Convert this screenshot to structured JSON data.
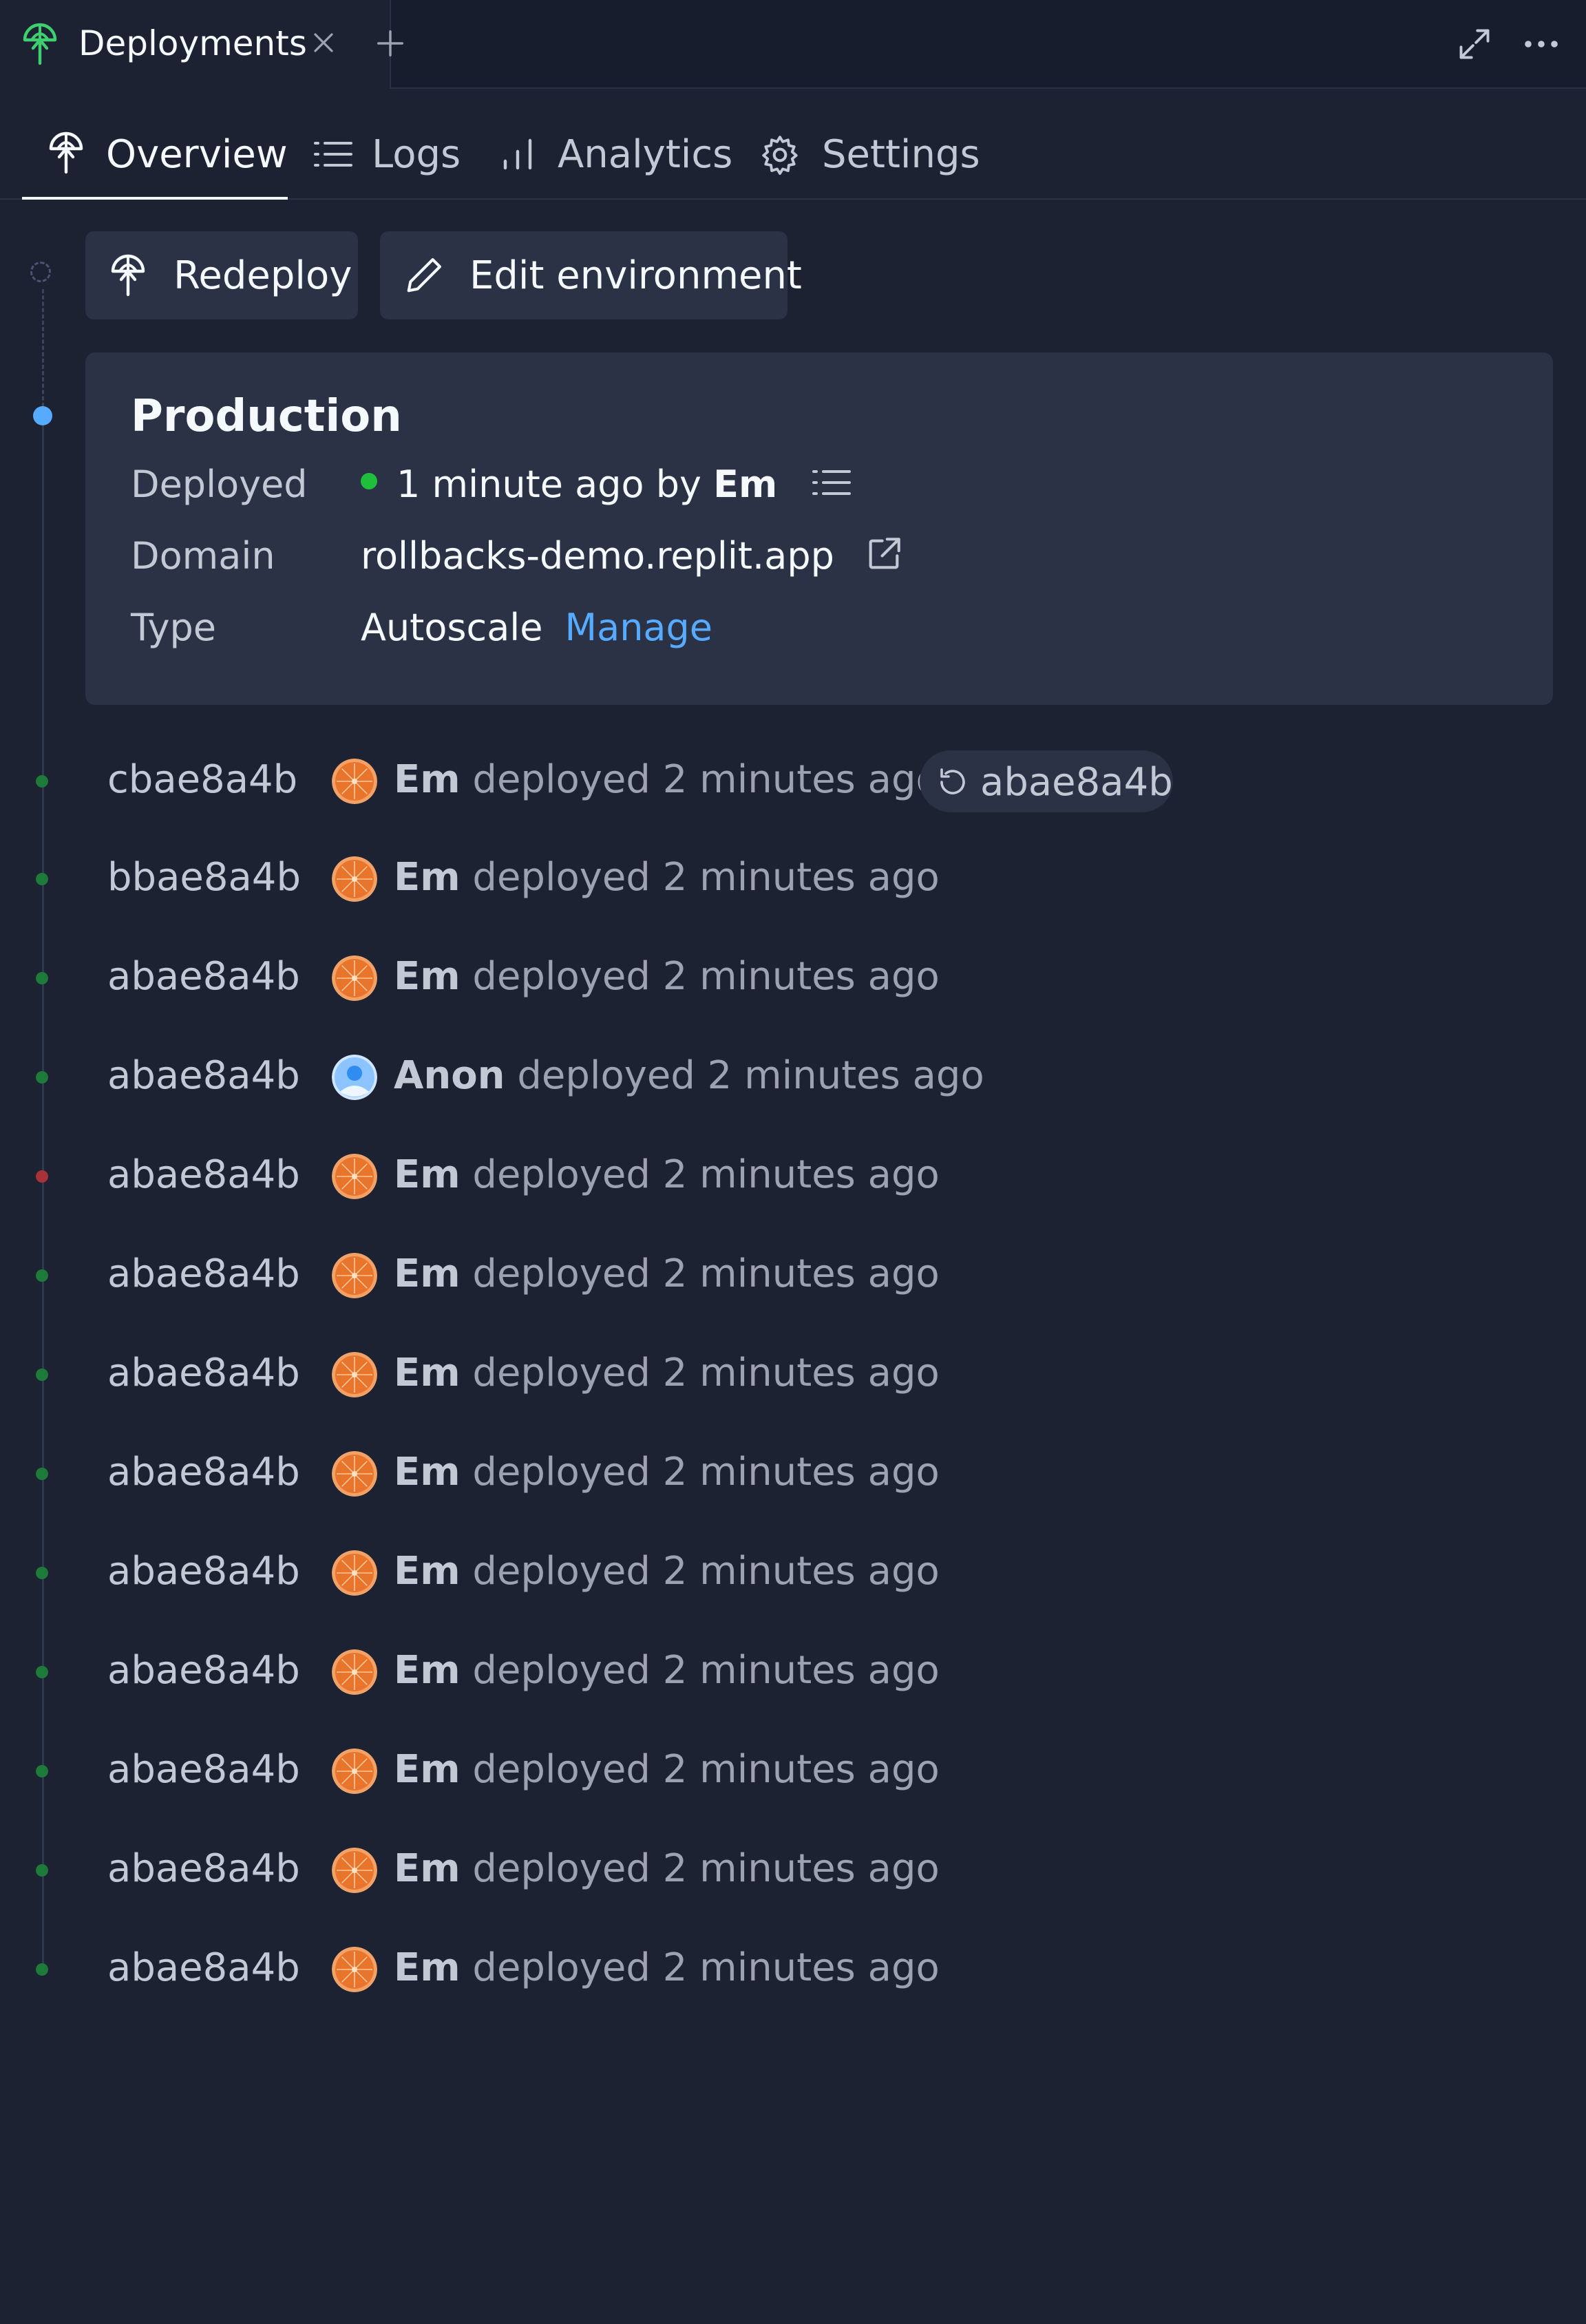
{
  "tab": {
    "title": "Deployments"
  },
  "colors": {
    "background": "#1c2232",
    "panel": "#2b3245",
    "accent_blue": "#57abff",
    "success_green": "#1fbf3b",
    "error_red": "#a8323a",
    "text_primary": "#f5f9fc",
    "text_secondary": "#c2c8d4"
  },
  "subnav": {
    "tabs": [
      {
        "label": "Overview",
        "icon": "deployments-icon",
        "active": true
      },
      {
        "label": "Logs",
        "icon": "list-icon"
      },
      {
        "label": "Analytics",
        "icon": "bar-chart-icon"
      },
      {
        "label": "Settings",
        "icon": "gear-icon"
      }
    ]
  },
  "actions": {
    "redeploy_label": "Redeploy",
    "edit_env_label": "Edit environment"
  },
  "production": {
    "title": "Production",
    "deployed_label": "Deployed",
    "deployed_value": "1 minute ago by",
    "deployed_by": "Em",
    "domain_label": "Domain",
    "domain_value": "rollbacks-demo.replit.app",
    "type_label": "Type",
    "type_value": "Autoscale",
    "manage_label": "Manage"
  },
  "history": [
    {
      "hash": "cbae8a4b",
      "user": "Em",
      "text": "deployed 2 minutes ago",
      "status": "success",
      "rollback": "abae8a4b",
      "avatar": "orange"
    },
    {
      "hash": "bbae8a4b",
      "user": "Em",
      "text": "deployed 2 minutes ago",
      "status": "success",
      "avatar": "orange"
    },
    {
      "hash": "abae8a4b",
      "user": "Em",
      "text": "deployed 2 minutes ago",
      "status": "success",
      "avatar": "orange"
    },
    {
      "hash": "abae8a4b",
      "user": "Anon",
      "text": "deployed 2 minutes ago",
      "status": "success",
      "avatar": "anon"
    },
    {
      "hash": "abae8a4b",
      "user": "Em",
      "text": "deployed 2 minutes ago",
      "status": "error",
      "avatar": "orange"
    },
    {
      "hash": "abae8a4b",
      "user": "Em",
      "text": "deployed 2 minutes ago",
      "status": "success",
      "avatar": "orange"
    },
    {
      "hash": "abae8a4b",
      "user": "Em",
      "text": "deployed 2 minutes ago",
      "status": "success",
      "avatar": "orange"
    },
    {
      "hash": "abae8a4b",
      "user": "Em",
      "text": "deployed 2 minutes ago",
      "status": "success",
      "avatar": "orange"
    },
    {
      "hash": "abae8a4b",
      "user": "Em",
      "text": "deployed 2 minutes ago",
      "status": "success",
      "avatar": "orange"
    },
    {
      "hash": "abae8a4b",
      "user": "Em",
      "text": "deployed 2 minutes ago",
      "status": "success",
      "avatar": "orange"
    },
    {
      "hash": "abae8a4b",
      "user": "Em",
      "text": "deployed 2 minutes ago",
      "status": "success",
      "avatar": "orange"
    },
    {
      "hash": "abae8a4b",
      "user": "Em",
      "text": "deployed 2 minutes ago",
      "status": "success",
      "avatar": "orange"
    },
    {
      "hash": "abae8a4b",
      "user": "Em",
      "text": "deployed 2 minutes ago",
      "status": "success",
      "avatar": "orange"
    }
  ]
}
